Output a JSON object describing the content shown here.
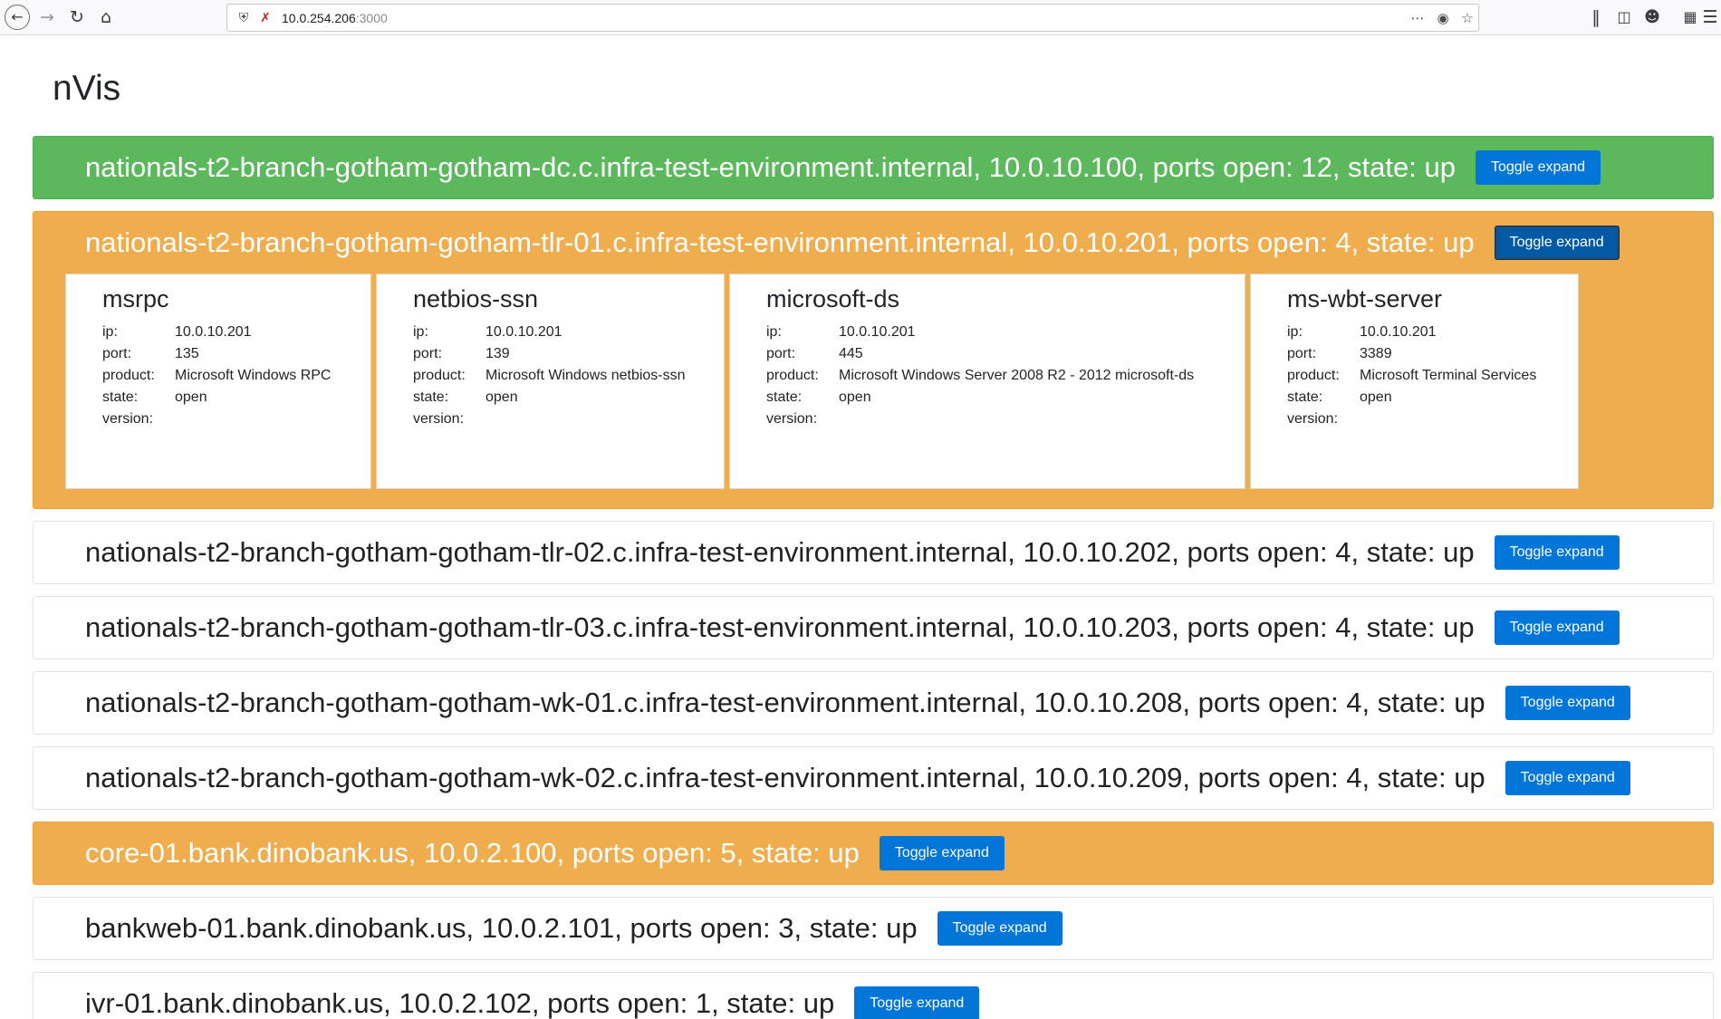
{
  "browser": {
    "url_host": "10.0.254.206",
    "url_port": ":3000"
  },
  "page": {
    "title": "nVis"
  },
  "toggle_label": "Toggle expand",
  "hosts": [
    {
      "title": "nationals-t2-branch-gotham-gotham-dc.c.infra-test-environment.internal, 10.0.10.100, ports open: 12, state: up",
      "style": "green",
      "expanded": false
    },
    {
      "title": "nationals-t2-branch-gotham-gotham-tlr-01.c.infra-test-environment.internal, 10.0.10.201, ports open: 4, state: up",
      "style": "orange",
      "expanded": true
    },
    {
      "title": "nationals-t2-branch-gotham-gotham-tlr-02.c.infra-test-environment.internal, 10.0.10.202, ports open: 4, state: up",
      "style": "white",
      "expanded": false
    },
    {
      "title": "nationals-t2-branch-gotham-gotham-tlr-03.c.infra-test-environment.internal, 10.0.10.203, ports open: 4, state: up",
      "style": "white",
      "expanded": false
    },
    {
      "title": "nationals-t2-branch-gotham-gotham-wk-01.c.infra-test-environment.internal, 10.0.10.208, ports open: 4, state: up",
      "style": "white",
      "expanded": false
    },
    {
      "title": "nationals-t2-branch-gotham-gotham-wk-02.c.infra-test-environment.internal, 10.0.10.209, ports open: 4, state: up",
      "style": "white",
      "expanded": false
    },
    {
      "title": "core-01.bank.dinobank.us, 10.0.2.100, ports open: 5, state: up",
      "style": "orange",
      "expanded": false
    },
    {
      "title": "bankweb-01.bank.dinobank.us, 10.0.2.101, ports open: 3, state: up",
      "style": "white",
      "expanded": false
    },
    {
      "title": "ivr-01.bank.dinobank.us, 10.0.2.102, ports open: 1, state: up",
      "style": "white",
      "expanded": false
    }
  ],
  "labels": {
    "ip": "ip:",
    "port": "port:",
    "product": "product:",
    "state": "state:",
    "version": "version:"
  },
  "ports": [
    {
      "name": "msrpc",
      "ip": "10.0.10.201",
      "port": "135",
      "product": "Microsoft Windows RPC",
      "state": "open",
      "version": ""
    },
    {
      "name": "netbios-ssn",
      "ip": "10.0.10.201",
      "port": "139",
      "product": "Microsoft Windows netbios-ssn",
      "state": "open",
      "version": ""
    },
    {
      "name": "microsoft-ds",
      "ip": "10.0.10.201",
      "port": "445",
      "product": "Microsoft Windows Server 2008 R2 - 2012 microsoft-ds",
      "state": "open",
      "version": ""
    },
    {
      "name": "ms-wbt-server",
      "ip": "10.0.10.201",
      "port": "3389",
      "product": "Microsoft Terminal Services",
      "state": "open",
      "version": ""
    }
  ]
}
